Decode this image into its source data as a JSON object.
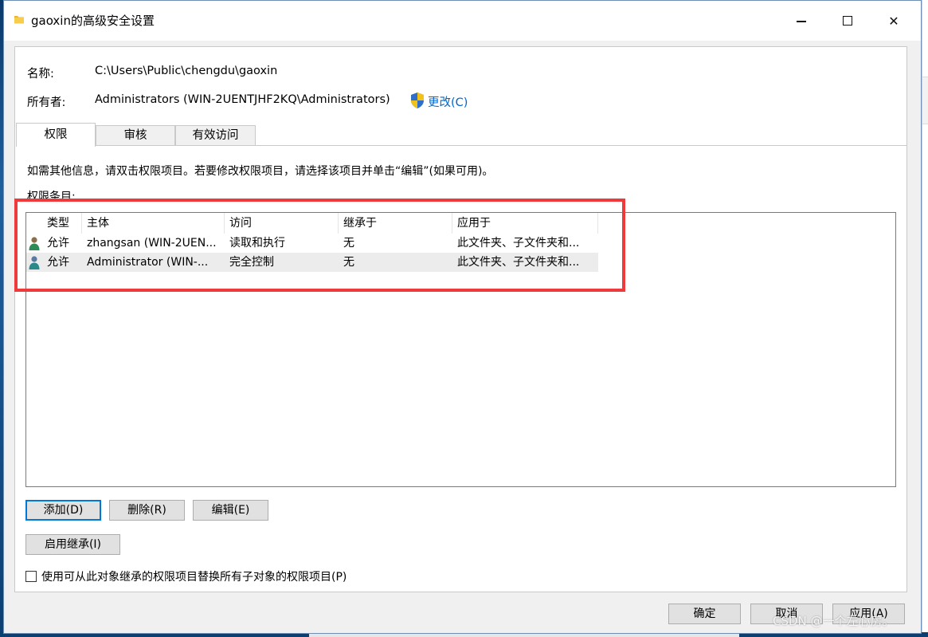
{
  "window": {
    "title": "gaoxin的高级安全设置",
    "controls": {
      "minimize": "minimize",
      "maximize": "maximize",
      "close": "✕"
    }
  },
  "info": {
    "name_label": "名称:",
    "name_value": "C:\\Users\\Public\\chengdu\\gaoxin",
    "owner_label": "所有者:",
    "owner_value": "Administrators (WIN-2UENTJHF2KQ\\Administrators)",
    "change_link": "更改(C)"
  },
  "tabs": [
    {
      "label": "权限",
      "active": true
    },
    {
      "label": "审核",
      "active": false
    },
    {
      "label": "有效访问",
      "active": false
    }
  ],
  "instructions": "如需其他信息，请双击权限项目。若要修改权限项目，请选择该项目并单击“编辑”(如果可用)。",
  "entries_label": "权限条目:",
  "table": {
    "headers": [
      "类型",
      "主体",
      "访问",
      "继承于",
      "应用于"
    ],
    "rows": [
      {
        "type": "允许",
        "principal": "zhangsan (WIN-2UEN...",
        "access": "读取和执行",
        "inherited_from": "无",
        "applies_to": "此文件夹、子文件夹和..."
      },
      {
        "type": "允许",
        "principal": "Administrator (WIN-...",
        "access": "完全控制",
        "inherited_from": "无",
        "applies_to": "此文件夹、子文件夹和..."
      }
    ]
  },
  "buttons": {
    "add": "添加(D)",
    "remove": "删除(R)",
    "edit": "编辑(E)",
    "enable_inheritance": "启用继承(I)",
    "ok": "确定",
    "cancel": "取消",
    "apply": "应用(A)"
  },
  "replace_checkbox_label": "使用可从此对象继承的权限项目替换所有子对象的权限项目(P)",
  "watermark": "CSDN @一个左心房。",
  "colors": {
    "highlight": "#ee3a3a",
    "link": "#0066cc",
    "accent": "#0078d7"
  },
  "icons": {
    "folder": "folder-icon",
    "shield": "uac-shield-icon",
    "user": "user-icon"
  }
}
